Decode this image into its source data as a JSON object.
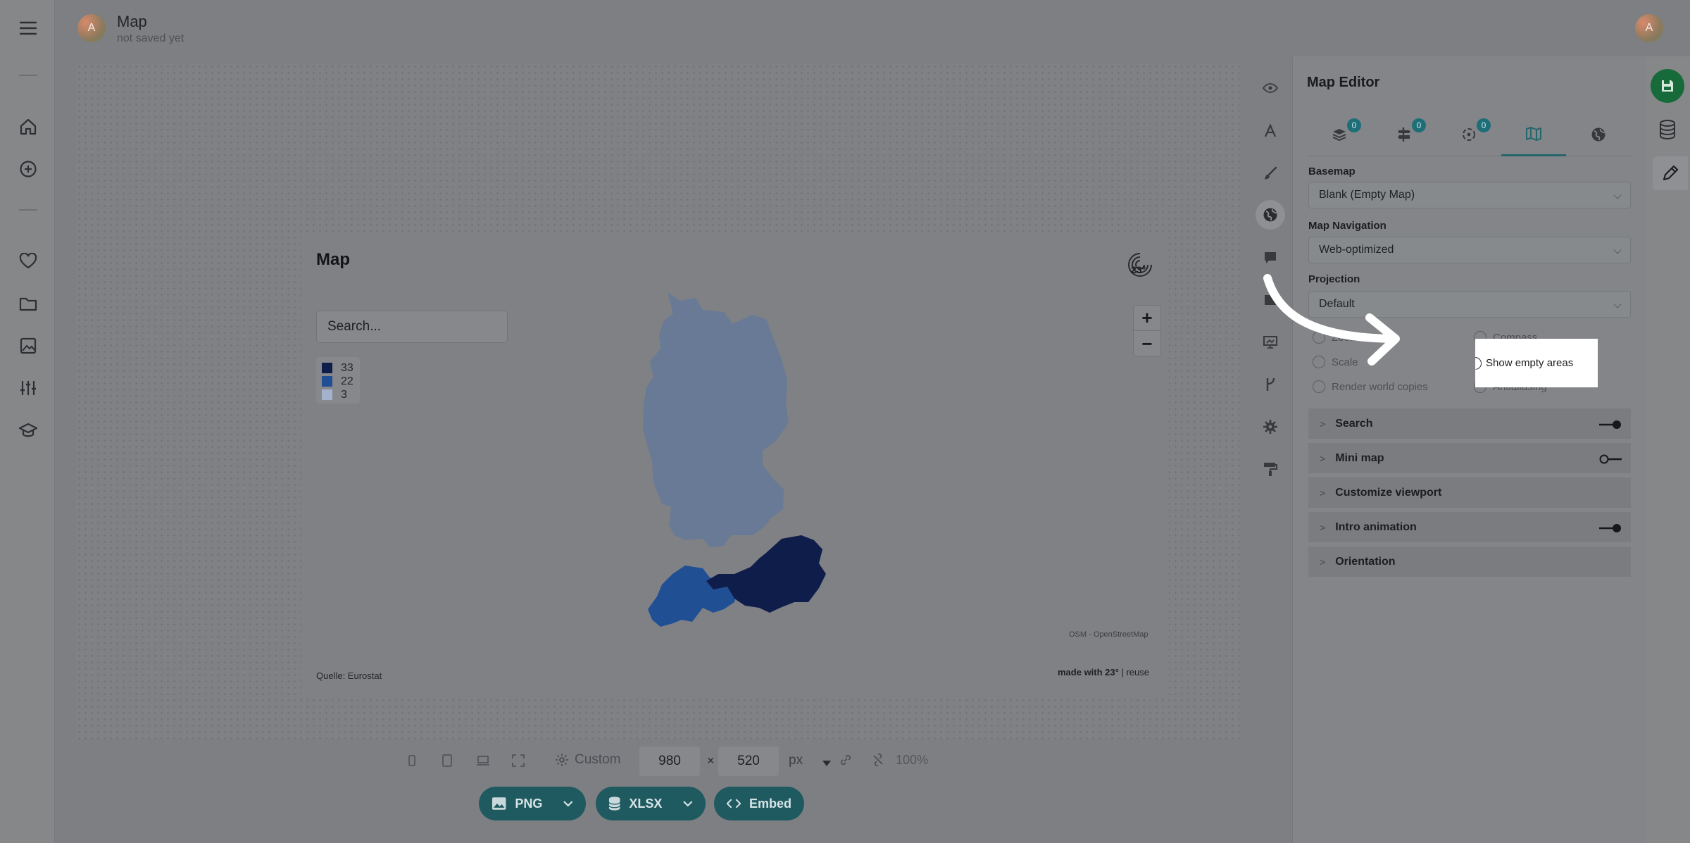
{
  "app": {
    "doc_title": "Map",
    "doc_subtitle": "not saved yet",
    "avatar_letter": "A"
  },
  "leftnav": {
    "items": [
      "menu-icon",
      "home-icon",
      "add-icon",
      "heart-icon",
      "folder-icon",
      "image-icon",
      "sliders-icon",
      "graduation-cap-icon"
    ]
  },
  "map": {
    "title": "Map",
    "search_placeholder": "Search...",
    "legend": [
      {
        "label": "33",
        "color": "#0f1d4b"
      },
      {
        "label": "22",
        "color": "#214f94"
      },
      {
        "label": "3",
        "color": "#a3b3cd"
      }
    ],
    "zoom_in": "+",
    "zoom_out": "−",
    "attribution": "OSM - OpenStreetMap",
    "source": "Quelle: Eurostat",
    "made_with": "made with 23°",
    "reuse": "| reuse",
    "logo_text": "23°",
    "region_colors": {
      "germany": "#687a95",
      "austria": "#0f1d4b",
      "switzerland": "#214f94"
    }
  },
  "bottom_toolbar": {
    "preset": "Custom",
    "width": "980",
    "times": "×",
    "height": "520",
    "unit": "px",
    "zoom": "100%",
    "export_png": "PNG",
    "export_xlsx": "XLSX",
    "export_embed": "Embed"
  },
  "editor": {
    "title": "Map Editor",
    "tab_badges": [
      "0",
      "0",
      "0"
    ],
    "basemap_label": "Basemap",
    "basemap_value": "Blank (Empty Map)",
    "navigation_label": "Map Navigation",
    "navigation_value": "Web-optimized",
    "projection_label": "Projection",
    "projection_value": "Default",
    "options": {
      "zoom_buttons": "Zoom buttons",
      "compass": "Compass",
      "scale": "Scale",
      "show_empty_areas": "Show empty areas",
      "render_world_copies": "Render world copies",
      "antialiasing": "Antialiasing"
    },
    "sections": [
      {
        "label": "Search",
        "toggle": "on"
      },
      {
        "label": "Mini map",
        "toggle": "off"
      },
      {
        "label": "Customize viewport",
        "toggle": "none"
      },
      {
        "label": "Intro animation",
        "toggle": "on"
      },
      {
        "label": "Orientation",
        "toggle": "none"
      }
    ]
  },
  "colors": {
    "accent": "#1f5a60",
    "save": "#176a3a",
    "highlight": "#ffffff"
  }
}
